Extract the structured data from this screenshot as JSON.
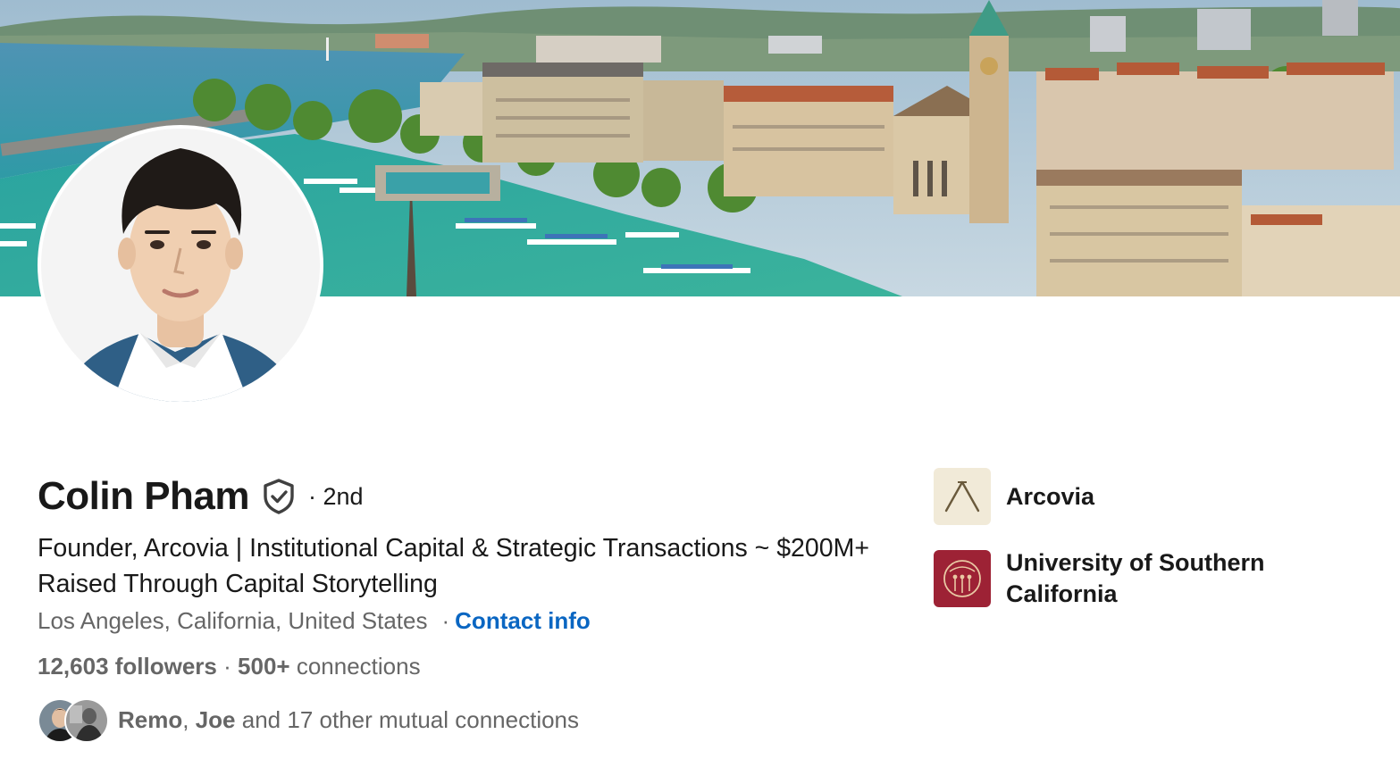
{
  "profile": {
    "name": "Colin Pham",
    "degree": "· 2nd",
    "headline": "Founder, Arcovia | Institutional Capital & Strategic Transactions ~ $200M+ Raised Through Capital Storytelling",
    "location": "Los Angeles, California, United States",
    "location_separator": "·",
    "contact_info": "Contact info",
    "followers": "12,603 followers",
    "stats_separator": "·",
    "connections_count": "500+",
    "connections_label": "connections",
    "mutual": {
      "name1": "Remo",
      "comma": ",",
      "name2": "Joe",
      "rest": "and 17 other mutual connections"
    }
  },
  "side": {
    "company": "Arcovia",
    "school": "University of Southern California"
  },
  "icons": {
    "verified": "shield-check-icon",
    "company_logo": "arcovia-logo",
    "school_logo": "usc-seal-logo"
  },
  "colors": {
    "link": "#0a66c2",
    "text": "#191919",
    "muted": "#666666",
    "usc_red": "#9d2235",
    "arcovia_bg": "#f1ead8"
  }
}
